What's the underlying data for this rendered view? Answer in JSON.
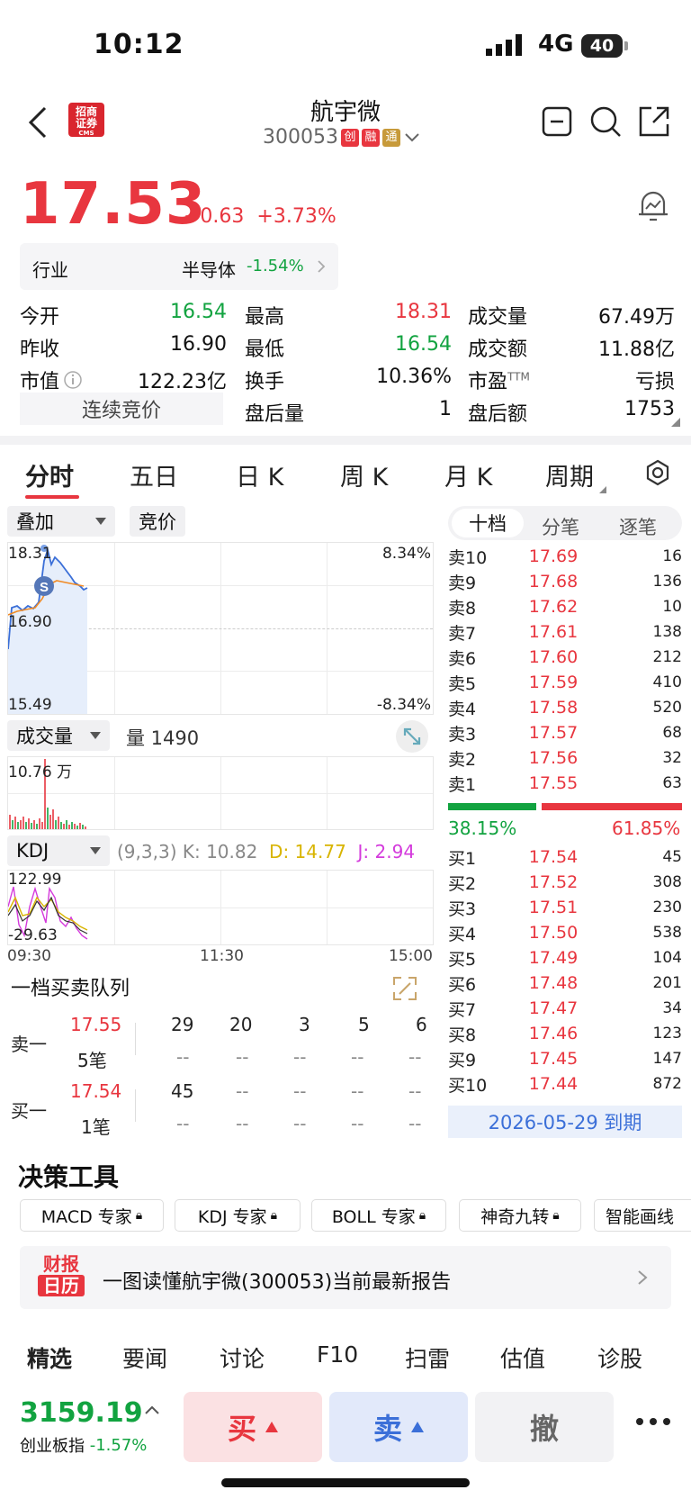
{
  "status": {
    "time": "10:12",
    "network": "4G",
    "battery": "40"
  },
  "header": {
    "name": "航宇微",
    "code": "300053",
    "tags": [
      "创",
      "融",
      "通"
    ],
    "logo": "招商\n证券",
    "logo_sub": "CMS"
  },
  "quote": {
    "price": "17.53",
    "change": "+0.63",
    "change_pct": "+3.73%",
    "industry_label": "行业",
    "industry_name": "半导体",
    "industry_pct": "-1.54%"
  },
  "stats": [
    [
      {
        "k": "今开",
        "v": "16.54",
        "c": "green"
      },
      {
        "k": "最高",
        "v": "18.31",
        "c": "red"
      },
      {
        "k": "成交量",
        "v": "67.49万",
        "c": "black"
      }
    ],
    [
      {
        "k": "昨收",
        "v": "16.90",
        "c": "black"
      },
      {
        "k": "最低",
        "v": "16.54",
        "c": "green"
      },
      {
        "k": "成交额",
        "v": "11.88亿",
        "c": "black"
      }
    ],
    [
      {
        "k": "市值",
        "v": "122.23亿",
        "c": "black"
      },
      {
        "k": "换手",
        "v": "10.36%",
        "c": "black"
      },
      {
        "k": "市盈",
        "v": "亏损",
        "c": "black"
      }
    ],
    [
      {
        "k": "连续竞价",
        "v": "",
        "c": "black"
      },
      {
        "k": "盘后量",
        "v": "1",
        "c": "black"
      },
      {
        "k": "盘后额",
        "v": "1753",
        "c": "black"
      }
    ]
  ],
  "pe_sup": "TTM",
  "tabs": [
    "分时",
    "五日",
    "日 K",
    "周 K",
    "月 K",
    "周期"
  ],
  "chart": {
    "overlay": "叠加",
    "auction": "竞价",
    "ymax": "18.31",
    "ymid": "16.90",
    "ymin": "15.49",
    "pmax": "8.34%",
    "pmin": "-8.34%",
    "vol_label": "成交量",
    "vol_value": "量 1490",
    "vol_max": "10.76 万",
    "kdj_label": "KDJ",
    "kdj_params": "(9,3,3)",
    "k": "K: 10.82",
    "d": "D: 14.77",
    "j": "J: 2.94",
    "kdj_max": "122.99",
    "kdj_min": "-29.63",
    "t0": "09:30",
    "t1": "11:30",
    "t2": "15:00"
  },
  "book_tabs": [
    "十档",
    "分笔",
    "逐笔"
  ],
  "asks": [
    [
      "卖10",
      "17.69",
      "16"
    ],
    [
      "卖9",
      "17.68",
      "136"
    ],
    [
      "卖8",
      "17.62",
      "10"
    ],
    [
      "卖7",
      "17.61",
      "138"
    ],
    [
      "卖6",
      "17.60",
      "212"
    ],
    [
      "卖5",
      "17.59",
      "410"
    ],
    [
      "卖4",
      "17.58",
      "520"
    ],
    [
      "卖3",
      "17.57",
      "68"
    ],
    [
      "卖2",
      "17.56",
      "32"
    ],
    [
      "卖1",
      "17.55",
      "63"
    ]
  ],
  "ratio": {
    "buy": "38.15%",
    "sell": "61.85%"
  },
  "bids": [
    [
      "买1",
      "17.54",
      "45"
    ],
    [
      "买2",
      "17.52",
      "308"
    ],
    [
      "买3",
      "17.51",
      "230"
    ],
    [
      "买4",
      "17.50",
      "538"
    ],
    [
      "买5",
      "17.49",
      "104"
    ],
    [
      "买6",
      "17.48",
      "201"
    ],
    [
      "买7",
      "17.47",
      "34"
    ],
    [
      "买8",
      "17.46",
      "123"
    ],
    [
      "买9",
      "17.45",
      "147"
    ],
    [
      "买10",
      "17.44",
      "872"
    ]
  ],
  "expire": "2026-05-29 到期",
  "queue": {
    "title": "一档买卖队列",
    "sell_label": "卖一",
    "sell_price": "17.55",
    "sell_count": "5笔",
    "sell_q": [
      "29",
      "20",
      "3",
      "5",
      "6"
    ],
    "buy_label": "买一",
    "buy_price": "17.54",
    "buy_count": "1笔",
    "buy_q": [
      "45",
      "--",
      "--",
      "--",
      "--"
    ],
    "dash": "--"
  },
  "tools": {
    "title": "决策工具",
    "items": [
      "MACD 专家",
      "KDJ 专家",
      "BOLL 专家",
      "神奇九转",
      "智能画线"
    ]
  },
  "report": {
    "icon_top": "财报",
    "icon_bottom": "日历",
    "text": "一图读懂航宇微(300053)当前最新报告"
  },
  "bottom_tabs": [
    "精选",
    "要闻",
    "讨论",
    "F10",
    "扫雷",
    "估值",
    "诊股"
  ],
  "index": {
    "value": "3159.19",
    "name": "创业板指",
    "pct": "-1.57%"
  },
  "actions": {
    "buy": "买",
    "sell": "卖",
    "cancel": "撤"
  }
}
